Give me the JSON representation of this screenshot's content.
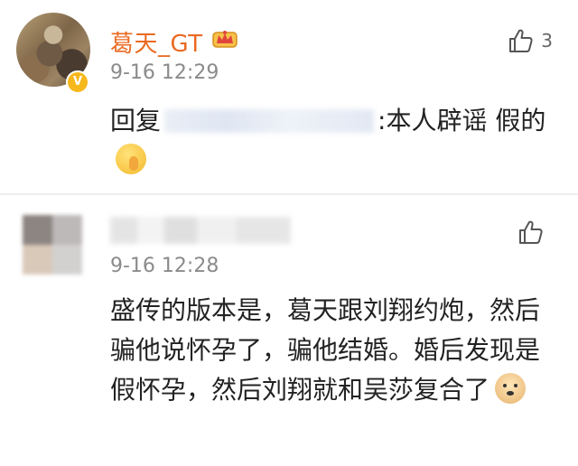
{
  "comments": [
    {
      "username": "葛天_GT",
      "time": "9-16 12:29",
      "likes": "3",
      "text_prefix": "回复",
      "text_main": ":本人辟谣 假的"
    },
    {
      "username": "",
      "time": "9-16 12:28",
      "likes": "",
      "text_main": "盛传的版本是，葛天跟刘翔约炮，然后骗他说怀孕了，骗他结婚。婚后发现是假怀孕，然后刘翔就和吴莎复合了"
    }
  ],
  "icons": {
    "like": "thumbs-up-icon",
    "badge": "crown-icon",
    "verified": "verified-v-icon",
    "emoji1": "shushing-face-emoji",
    "emoji2": "doge-emoji"
  },
  "colors": {
    "username": "#ea6a22",
    "time": "#8b8b8b",
    "text": "#222222",
    "verified": "#f6b81c"
  }
}
